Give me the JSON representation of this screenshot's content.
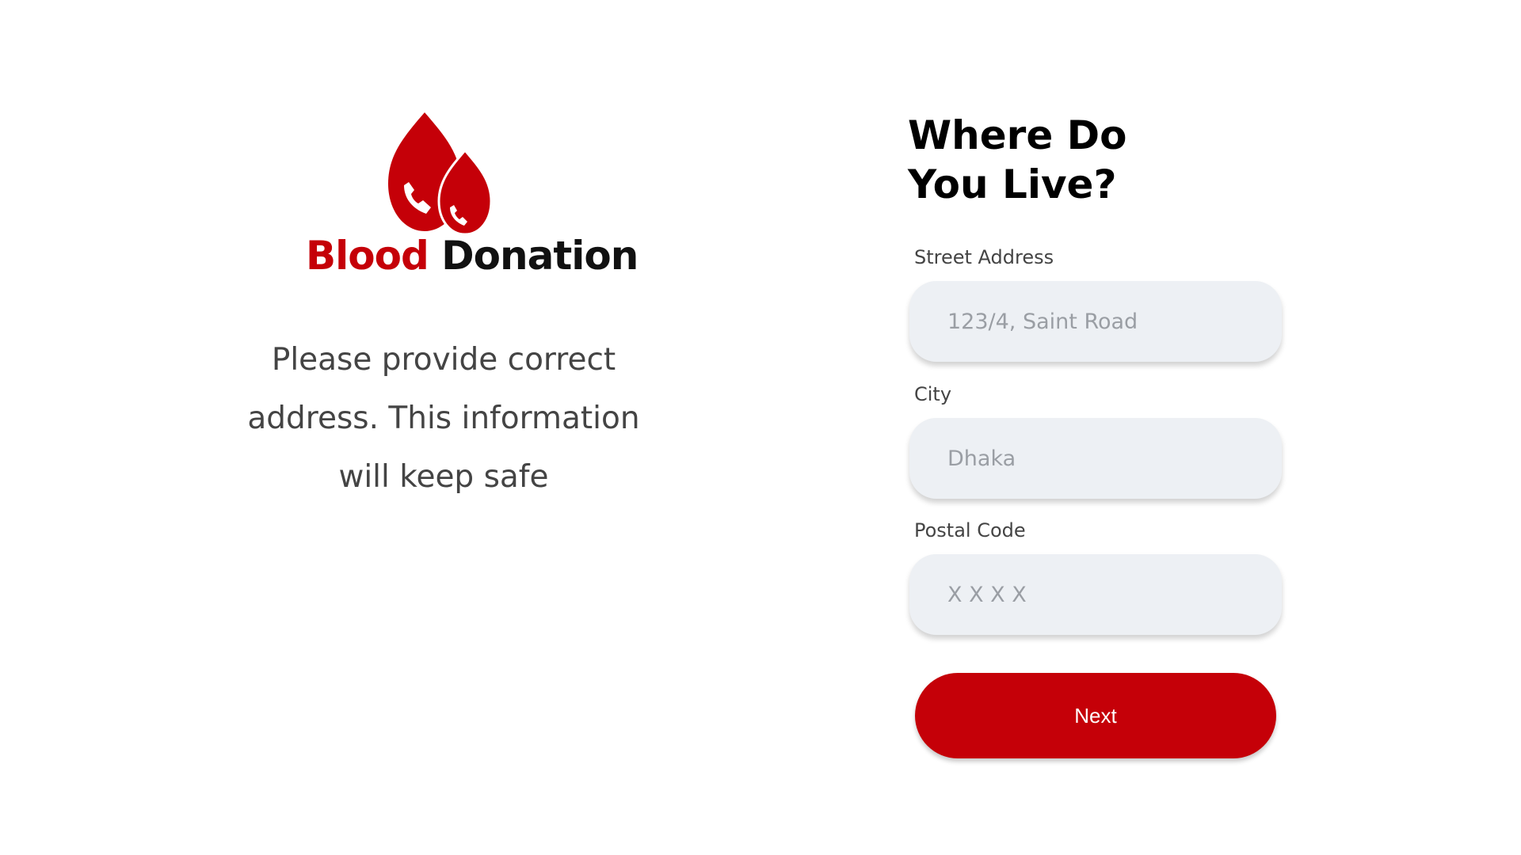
{
  "brand": {
    "name_part1": "Blood",
    "name_part2": "Donation",
    "logo_icon": "blood-drop-phone-icon",
    "accent_color": "#c50008"
  },
  "intro": {
    "line1": "Please provide correct",
    "line2": "address. This information",
    "line3": "will keep safe"
  },
  "form": {
    "heading_line1": "Where Do",
    "heading_line2": "You Live?",
    "street": {
      "label": "Street Address",
      "placeholder": "123/4, Saint Road"
    },
    "city": {
      "label": "City",
      "placeholder": "Dhaka"
    },
    "postal": {
      "label": "Postal Code",
      "placeholder": "X X X X"
    },
    "next_label": "Next"
  }
}
